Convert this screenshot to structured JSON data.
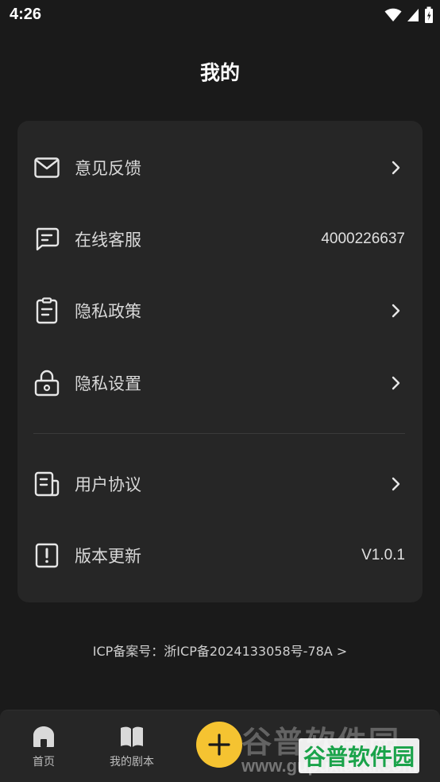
{
  "status_bar": {
    "time": "4:26"
  },
  "header": {
    "title": "我的"
  },
  "menu": {
    "items": [
      {
        "label": "意见反馈",
        "icon": "mail-icon",
        "right": ""
      },
      {
        "label": "在线客服",
        "icon": "chat-icon",
        "right": "4000226637"
      },
      {
        "label": "隐私政策",
        "icon": "clipboard-icon",
        "right": ""
      },
      {
        "label": "隐私设置",
        "icon": "lock-icon",
        "right": ""
      },
      {
        "label": "用户协议",
        "icon": "document-icon",
        "right": ""
      },
      {
        "label": "版本更新",
        "icon": "alert-icon",
        "right": "V1.0.1"
      }
    ]
  },
  "footer": {
    "icp": "ICP备案号：浙ICP备2024133058号-78A >"
  },
  "tabbar": {
    "tabs": [
      {
        "label": "首页",
        "icon": "home-icon"
      },
      {
        "label": "我的剧本",
        "icon": "book-icon"
      }
    ],
    "fab_icon": "plus-icon",
    "fab_color": "#f5c331"
  },
  "watermark": {
    "text": "谷普软件园",
    "url": "www.gupuxiazai.com"
  }
}
